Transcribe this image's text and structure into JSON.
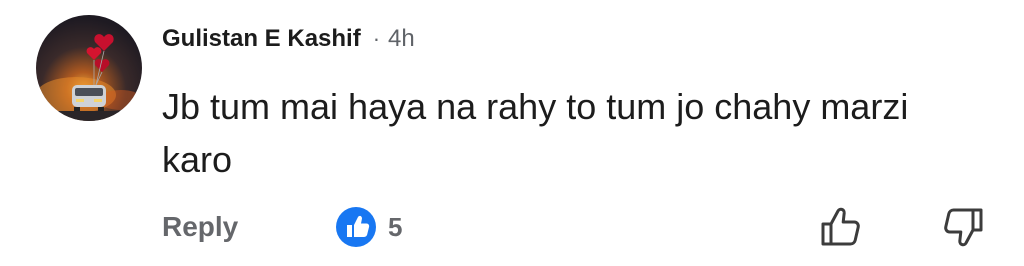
{
  "comment": {
    "author": "Gulistan E Kashif",
    "separator": "·",
    "time": "4h",
    "text": "Jb tum mai haya na rahy to tum jo chahy marzi karo"
  },
  "actions": {
    "reply_label": "Reply",
    "like_count": "5"
  },
  "icons": {
    "like_badge": "like-badge-icon",
    "upvote": "thumbs-up-outline-icon",
    "downvote": "thumbs-down-outline-icon"
  },
  "colors": {
    "like_badge": "#1877f2",
    "muted_text": "#65676b",
    "primary_text": "#1c1c1c"
  }
}
